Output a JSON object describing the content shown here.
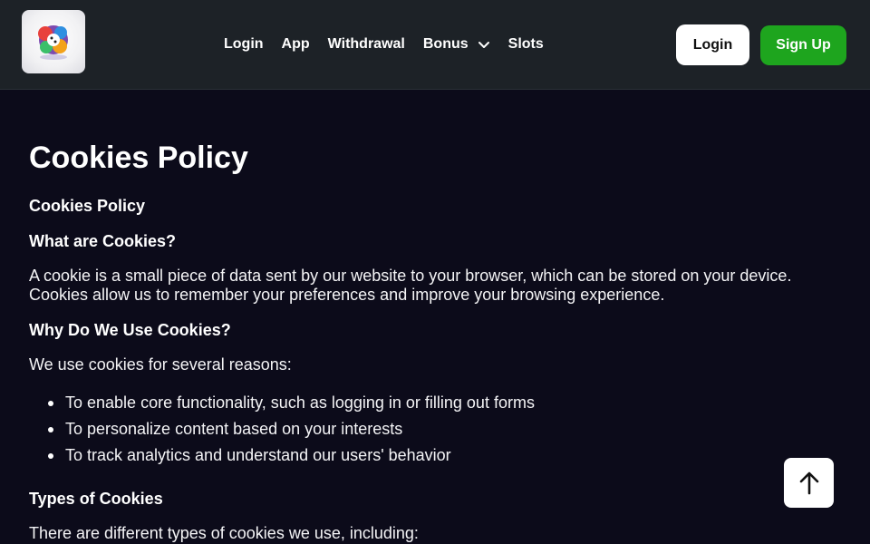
{
  "header": {
    "logo_icon": "colorful-dice-logo-icon",
    "nav": [
      {
        "label": "Login"
      },
      {
        "label": "App"
      },
      {
        "label": "Withdrawal"
      },
      {
        "label": "Bonus",
        "has_dropdown": true
      },
      {
        "label": "Slots"
      }
    ],
    "login_label": "Login",
    "signup_label": "Sign Up",
    "colors": {
      "signup": "#1ea51e",
      "header_bg": "#1d2227",
      "page_bg": "#0c0b1a"
    }
  },
  "main": {
    "title": "Cookies Policy",
    "subtitle": "Cookies Policy",
    "what_heading": "What are Cookies?",
    "what_text": "A cookie is a small piece of data sent by our website to your browser, which can be stored on your device. Cookies allow us to remember your preferences and improve your browsing experience.",
    "why_heading": "Why Do We Use Cookies?",
    "why_text": "We use cookies for several reasons:",
    "reasons": [
      "To enable core functionality, such as logging in or filling out forms",
      "To personalize content based on your interests",
      "To track analytics and understand our users' behavior"
    ],
    "types_heading": "Types of Cookies",
    "types_text": "There are different types of cookies we use, including:"
  },
  "scroll_top_icon": "arrow-up-icon"
}
